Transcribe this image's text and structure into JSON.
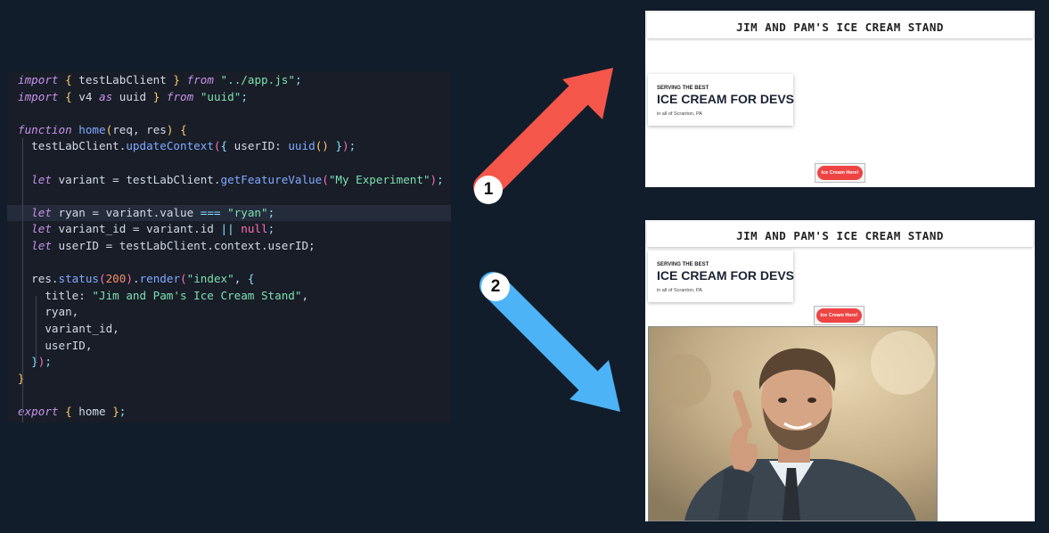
{
  "code_editor": {
    "lines": [
      [
        {
          "t": "import",
          "c": "kw"
        },
        {
          "t": " "
        },
        {
          "t": "{",
          "c": "pb"
        },
        {
          "t": " testLabClient "
        },
        {
          "t": "}",
          "c": "pb"
        },
        {
          "t": " "
        },
        {
          "t": "from",
          "c": "kw"
        },
        {
          "t": " "
        },
        {
          "t": "\"../app.js\"",
          "c": "str"
        },
        {
          "t": ";",
          "c": "pc"
        }
      ],
      [
        {
          "t": "import",
          "c": "kw"
        },
        {
          "t": " "
        },
        {
          "t": "{",
          "c": "pb"
        },
        {
          "t": " v4 "
        },
        {
          "t": "as",
          "c": "kw"
        },
        {
          "t": " uuid "
        },
        {
          "t": "}",
          "c": "pb"
        },
        {
          "t": " "
        },
        {
          "t": "from",
          "c": "kw"
        },
        {
          "t": " "
        },
        {
          "t": "\"uuid\"",
          "c": "str"
        },
        {
          "t": ";",
          "c": "pc"
        }
      ],
      [],
      [
        {
          "t": "function",
          "c": "kw"
        },
        {
          "t": " "
        },
        {
          "t": "home",
          "c": "fn"
        },
        {
          "t": "(",
          "c": "pb"
        },
        {
          "t": "req, res"
        },
        {
          "t": ")",
          "c": "pb"
        },
        {
          "t": " "
        },
        {
          "t": "{",
          "c": "pb"
        }
      ],
      [
        {
          "t": "  testLabClient."
        },
        {
          "t": "updateContext",
          "c": "fn"
        },
        {
          "t": "(",
          "c": "pk"
        },
        {
          "t": "{",
          "c": "pc"
        },
        {
          "t": " userID: "
        },
        {
          "t": "uuid",
          "c": "fn"
        },
        {
          "t": "()",
          "c": "pb"
        },
        {
          "t": " "
        },
        {
          "t": "}",
          "c": "pc"
        },
        {
          "t": ")",
          "c": "pk"
        },
        {
          "t": ";",
          "c": "pc"
        }
      ],
      [],
      [
        {
          "t": "  "
        },
        {
          "t": "let",
          "c": "kw"
        },
        {
          "t": " variant = testLabClient."
        },
        {
          "t": "getFeatureValue",
          "c": "fn"
        },
        {
          "t": "(",
          "c": "pk"
        },
        {
          "t": "\"My Experiment\"",
          "c": "str"
        },
        {
          "t": ")",
          "c": "pk"
        },
        {
          "t": ";",
          "c": "pc"
        }
      ],
      [],
      [
        {
          "t": "  "
        },
        {
          "t": "let",
          "c": "kw"
        },
        {
          "t": " ryan = variant.value "
        },
        {
          "t": "===",
          "c": "pc"
        },
        {
          "t": " "
        },
        {
          "t": "\"ryan\"",
          "c": "str"
        },
        {
          "t": ";",
          "c": "pc"
        }
      ],
      [
        {
          "t": "  "
        },
        {
          "t": "let",
          "c": "kw"
        },
        {
          "t": " variant_id = variant.id "
        },
        {
          "t": "||",
          "c": "pc"
        },
        {
          "t": " "
        },
        {
          "t": "null",
          "c": "pk"
        },
        {
          "t": ";",
          "c": "pc"
        }
      ],
      [
        {
          "t": "  "
        },
        {
          "t": "let",
          "c": "kw"
        },
        {
          "t": " userID = testLabClient.context.userID;"
        }
      ],
      [],
      [
        {
          "t": "  res."
        },
        {
          "t": "status",
          "c": "fn"
        },
        {
          "t": "(",
          "c": "pk"
        },
        {
          "t": "200",
          "c": "num"
        },
        {
          "t": ")",
          "c": "pk"
        },
        {
          "t": "."
        },
        {
          "t": "render",
          "c": "fn"
        },
        {
          "t": "(",
          "c": "pk"
        },
        {
          "t": "\"index\"",
          "c": "str"
        },
        {
          "t": ", "
        },
        {
          "t": "{",
          "c": "pc"
        }
      ],
      [
        {
          "t": "    title: "
        },
        {
          "t": "\"Jim and Pam's Ice Cream Stand\"",
          "c": "str"
        },
        {
          "t": ","
        }
      ],
      [
        {
          "t": "    ryan,"
        }
      ],
      [
        {
          "t": "    variant_id,"
        }
      ],
      [
        {
          "t": "    userID,"
        }
      ],
      [
        {
          "t": "  "
        },
        {
          "t": "}",
          "c": "pc"
        },
        {
          "t": ")",
          "c": "pk"
        },
        {
          "t": ";",
          "c": "pc"
        }
      ],
      [
        {
          "t": "}",
          "c": "pb"
        }
      ],
      [],
      [
        {
          "t": "export",
          "c": "kw"
        },
        {
          "t": " "
        },
        {
          "t": "{",
          "c": "pb"
        },
        {
          "t": " home "
        },
        {
          "t": "}",
          "c": "pb"
        },
        {
          "t": ";",
          "c": "pc"
        }
      ]
    ]
  },
  "variant_1": {
    "badge": "1",
    "header_title": "JIM AND PAM'S ICE CREAM STAND",
    "hero_kicker": "SERVING THE BEST",
    "hero_title": "ICE CREAM FOR DEVS",
    "hero_location": "in all of Scranton, PA",
    "button_label": "Ice Cream Here!"
  },
  "variant_2": {
    "badge": "2",
    "header_title": "JIM AND PAM'S ICE CREAM STAND",
    "hero_kicker": "SERVING THE BEST",
    "hero_title": "ICE CREAM FOR DEVS",
    "hero_location": "in all of Scranton, PA",
    "button_label": "Ice Cream Here!",
    "photo": "smiling-man-pointing-photo"
  },
  "colors": {
    "background": "#121d2b",
    "arrow_1": "#f4564a",
    "arrow_2": "#4db3f7",
    "button": "#ee4444"
  }
}
